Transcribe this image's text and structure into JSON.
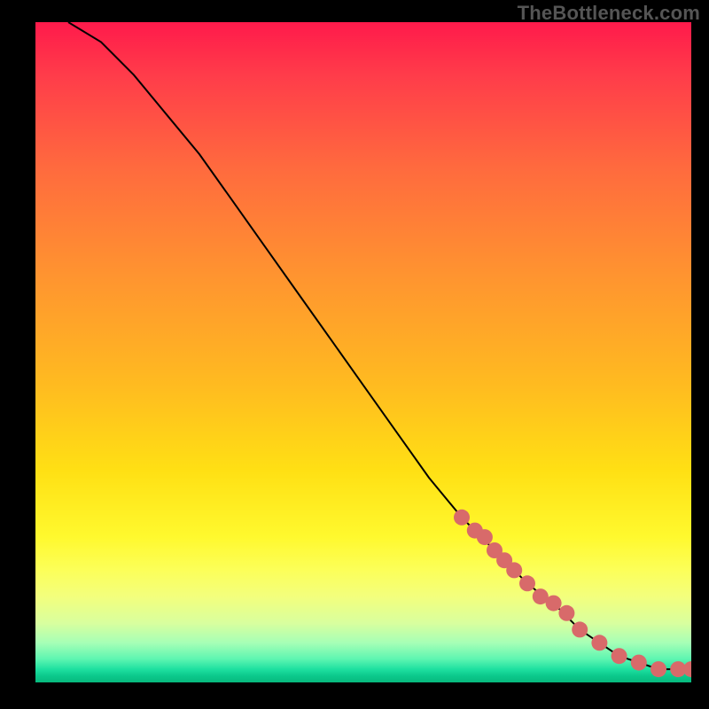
{
  "watermark": "TheBottleneck.com",
  "chart_data": {
    "type": "line",
    "title": "",
    "xlabel": "",
    "ylabel": "",
    "xlim": [
      0,
      100
    ],
    "ylim": [
      0,
      100
    ],
    "grid": false,
    "series": [
      {
        "name": "bottleneck-curve",
        "x": [
          5,
          10,
          15,
          20,
          25,
          30,
          35,
          40,
          45,
          50,
          55,
          60,
          65,
          70,
          75,
          80,
          83,
          86,
          89,
          92,
          95,
          98,
          100
        ],
        "y": [
          100,
          97,
          92,
          86,
          80,
          73,
          66,
          59,
          52,
          45,
          38,
          31,
          25,
          20,
          15,
          11,
          8,
          6,
          4,
          3,
          2,
          2,
          2
        ]
      }
    ],
    "markers": {
      "name": "highlight-points",
      "x": [
        65,
        67,
        68.5,
        70,
        71.5,
        73,
        75,
        77,
        79,
        81,
        83,
        86,
        89,
        92,
        95,
        98,
        100
      ],
      "y": [
        25,
        23,
        22,
        20,
        18.5,
        17,
        15,
        13,
        12,
        10.5,
        8,
        6,
        4,
        3,
        2,
        2,
        2
      ]
    },
    "colors": {
      "curve": "#000000",
      "marker_fill": "#d86a6a",
      "gradient_top": "#ff1a4b",
      "gradient_mid": "#ffe014",
      "gradient_bottom": "#07b97d"
    }
  }
}
